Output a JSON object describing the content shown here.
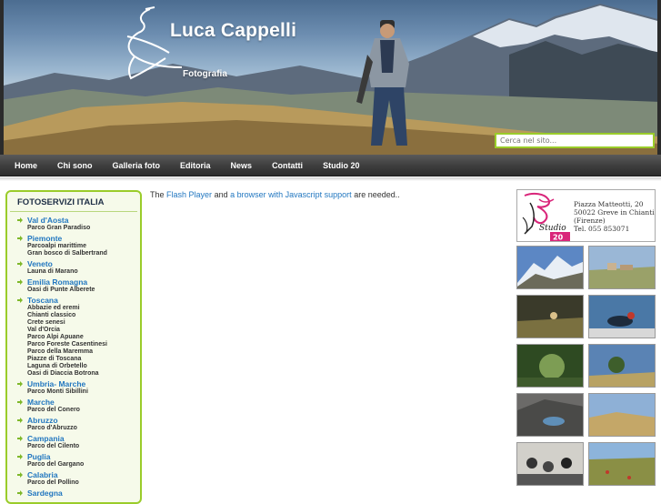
{
  "site": {
    "title": "Luca Cappelli",
    "subtitle": "Fotografia"
  },
  "search": {
    "placeholder": "Cerca nel sito..."
  },
  "nav": {
    "items": [
      "Home",
      "Chi sono",
      "Galleria foto",
      "Editoria",
      "News",
      "Contatti",
      "Studio 20"
    ]
  },
  "sidebar": {
    "title": "FOTOSERVIZI ITALIA",
    "regions": [
      {
        "name": "Val d'Aosta",
        "items": [
          "Parco Gran Paradiso"
        ]
      },
      {
        "name": "Piemonte",
        "items": [
          "Parcoalpi marittime",
          "Gran bosco di Salbertrand"
        ]
      },
      {
        "name": "Veneto",
        "items": [
          "Launa di Marano"
        ]
      },
      {
        "name": "Emilia Romagna",
        "items": [
          "Oasi di Punte Alberete"
        ]
      },
      {
        "name": "Toscana",
        "items": [
          "Abbazie ed eremi",
          "Chianti classico",
          "Crete senesi",
          "Val d'Orcia",
          "Parco Alpi Apuane",
          "Parco Foreste Casentinesi",
          "Parco della Maremma",
          "Piazze di Toscana",
          "Laguna di Orbetello",
          "Oasi di Diaccia Botrona"
        ]
      },
      {
        "name": "Umbria- Marche",
        "items": [
          "Parco Monti Sibillini"
        ]
      },
      {
        "name": "Marche",
        "items": [
          "Parco del Conero"
        ]
      },
      {
        "name": "Abruzzo",
        "items": [
          "Parco d'Abruzzo"
        ]
      },
      {
        "name": "Campania",
        "items": [
          "Parco del Cilento"
        ]
      },
      {
        "name": "Puglia",
        "items": [
          "Parco del Gargano"
        ]
      },
      {
        "name": "Calabria",
        "items": [
          "Parco del Pollino"
        ]
      },
      {
        "name": "Sardegna",
        "items": []
      }
    ]
  },
  "main": {
    "msg_prefix": "The",
    "flash_link": "Flash Player",
    "msg_and": "and",
    "browser_link": "a browser with Javascript support",
    "msg_suffix": "are needed.."
  },
  "ad": {
    "logo_text": "Studio 20",
    "address_lines": [
      "Piazza Matteotti, 20",
      "50022 Greve in Chianti",
      "(Firenze)",
      "Tel. 055 853071"
    ]
  },
  "colors": {
    "accent_green": "#9acc2a",
    "link_blue": "#2277c0",
    "nav_dark": "#3f3f3f",
    "logo_pink": "#d9257a"
  }
}
